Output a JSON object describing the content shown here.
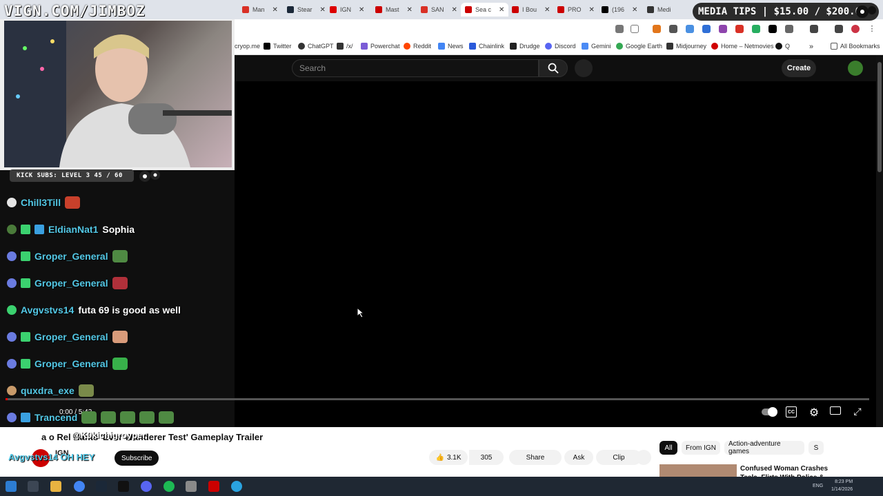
{
  "browser": {
    "tabs": [
      {
        "label": "Man",
        "color": "#d93025"
      },
      {
        "label": "Stear",
        "color": "#1b2838"
      },
      {
        "label": "IGN",
        "color": "#d00"
      },
      {
        "label": "Mast",
        "color": "#c00"
      },
      {
        "label": "SAN",
        "color": "#d93025"
      },
      {
        "label": "Sea c",
        "color": "#c00"
      },
      {
        "label": "I Bou",
        "color": "#c00"
      },
      {
        "label": "PRO",
        "color": "#c00"
      },
      {
        "label": "(196",
        "color": "#000"
      },
      {
        "label": "Medi",
        "color": "#333"
      }
    ],
    "bookmarks": [
      {
        "label": "cryop.me",
        "color": "#ffffff"
      },
      {
        "label": "Twitter",
        "color": "#000000"
      },
      {
        "label": "ChatGPT",
        "color": "#333333"
      },
      {
        "label": "/x/",
        "color": "#333333"
      },
      {
        "label": "Powerchat",
        "color": "#7b5cd6"
      },
      {
        "label": "Reddit",
        "color": "#ff4500"
      },
      {
        "label": "News",
        "color": "#4285f4"
      },
      {
        "label": "Chainlink",
        "color": "#2a5ada"
      },
      {
        "label": "Drudge",
        "color": "#222222"
      },
      {
        "label": "Discord",
        "color": "#5865f2"
      },
      {
        "label": "Gemini",
        "color": "#4b8bf5"
      },
      {
        "label": "Google Earth",
        "color": "#34a853"
      },
      {
        "label": "Midjourney",
        "color": "#333333"
      },
      {
        "label": "Home – Netmovies",
        "color": "#d00000"
      },
      {
        "label": "Q",
        "color": "#111111"
      }
    ],
    "all_bookmarks": "All Bookmarks"
  },
  "youtube": {
    "search_placeholder": "Search",
    "create": "Create",
    "time": "0:00 / 5:42",
    "played_fraction": 0.0,
    "video_title": "a o Rel Hants  'Ever Wanderer Test' Gameplay Trailer",
    "channel": "IGN",
    "subscribe": "Subscribe",
    "likes": "3.1K",
    "dislikes": "305",
    "share": "Share",
    "ask": "Ask",
    "clip": "Clip",
    "chips": [
      "All",
      "From IGN",
      "Action-adventure games",
      "S"
    ],
    "rec_title": "Confused Woman Crashes Tesla, Flirts With Police & Has"
  },
  "stream": {
    "logo": "VIGN.COM/JIMBOZ",
    "kick_subs": "KICK SUBS: LEVEL 3 45 / 60",
    "media_tips": "MEDIA TIPS | $15.00 / $200.00",
    "chat": [
      {
        "user": "Chill3Till",
        "text": "",
        "user_color": "#53c8e6"
      },
      {
        "user": "EldianNat1",
        "text": "Sophia",
        "user_color": "#53c8e6"
      },
      {
        "user": "Groper_General",
        "text": "",
        "user_color": "#53c8e6"
      },
      {
        "user": "Groper_General",
        "text": "",
        "user_color": "#53c8e6"
      },
      {
        "user": "Avgvstvs14",
        "text": "futa 69 is good as well",
        "user_color": "#53c8e6"
      },
      {
        "user": "Groper_General",
        "text": "",
        "user_color": "#53c8e6"
      },
      {
        "user": "Groper_General",
        "text": "",
        "user_color": "#53c8e6"
      },
      {
        "user": "quxdra_exe",
        "text": "",
        "user_color": "#53c8e6"
      },
      {
        "user": "Trancend",
        "text": "",
        "user_color": "#53c8e6"
      }
    ],
    "overlay_mention": "@K0kichigroyper",
    "overlay_last": "Avgvstvs14  OH HEY"
  },
  "taskbar": {
    "clock_time": "8:23 PM",
    "clock_date": "1/14/2026",
    "lang": "ENG"
  }
}
